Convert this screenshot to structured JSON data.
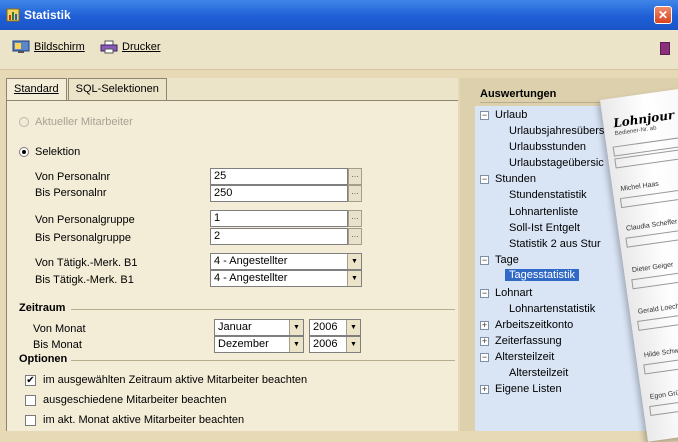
{
  "window": {
    "title": "Statistik",
    "close_glyph": "✕"
  },
  "toolbar": {
    "screen_label": "Bildschirm",
    "printer_label": "Drucker"
  },
  "tabs": [
    {
      "label": "Standard",
      "active": true
    },
    {
      "label": "SQL-Selektionen",
      "active": false
    }
  ],
  "standard": {
    "radio_current": "Aktueller Mitarbeiter",
    "radio_selection": "Selektion",
    "from_personnel_no_label": "Von Personalnr",
    "from_personnel_no": "25",
    "to_personnel_no_label": "Bis Personalnr",
    "to_personnel_no": "250",
    "from_group_label": "Von Personalgruppe",
    "from_group": "1",
    "to_group_label": "Bis Personalgruppe",
    "to_group": "2",
    "from_activity_label": "Von Tätigk.-Merk. B1",
    "from_activity": "4 - Angestellter",
    "to_activity_label": "Bis Tätigk.-Merk. B1",
    "to_activity": "4 - Angestellter",
    "period_heading": "Zeitraum",
    "from_month_label": "Von  Monat",
    "from_month": "Januar",
    "from_year": "2006",
    "to_month_label": "Bis Monat",
    "to_month": "Dezember",
    "to_year": "2006",
    "options_heading": "Optionen",
    "option_active_period": "im ausgewählten Zeitraum aktive Mitarbeiter beachten",
    "option_active_period_checked": true,
    "option_leavers": "ausgeschiedene Mitarbeiter beachten",
    "option_leavers_checked": false,
    "option_active_month": "im akt. Monat aktive Mitarbeiter beachten",
    "option_active_month_checked": false
  },
  "evaluations": {
    "heading": "Auswertungen",
    "nodes": [
      {
        "label": "Urlaub",
        "expander": "−"
      },
      {
        "label": "Urlaubsjahresübersic"
      },
      {
        "label": "Urlaubsstunden"
      },
      {
        "label": "Urlaubstageübersic"
      },
      {
        "label": "Stunden",
        "expander": "−"
      },
      {
        "label": "Stundenstatistik"
      },
      {
        "label": "Lohnartenliste"
      },
      {
        "label": "Soll-Ist Entgelt"
      },
      {
        "label": "Statistik 2 aus Stur"
      },
      {
        "label": "Tage",
        "expander": "−"
      },
      {
        "label": "Tagesstatistik",
        "selected": true
      },
      {
        "label": "Lohnart",
        "expander": "−"
      },
      {
        "label": "Lohnartenstatistik"
      },
      {
        "label": "Arbeitszeitkonto",
        "expander": "+"
      },
      {
        "label": "Zeiterfassung",
        "expander": "+"
      },
      {
        "label": "Altersteilzeit",
        "expander": "−"
      },
      {
        "label": "Altersteilzeit"
      },
      {
        "label": "Eigene Listen",
        "expander": "+"
      }
    ]
  },
  "report_preview": {
    "title": "Lohnjour",
    "subtitle": "Bediener-Nr. ab",
    "names": [
      "Michel Haas",
      "Claudia Scheffer",
      "Dieter Geiger",
      "Gerald Loeches",
      "Hilde Schwarz",
      "Egon Grüner"
    ]
  },
  "colors": {
    "titlebar": "#1f5ed6",
    "selection": "#3169c6",
    "tree_bg": "#d9e4f5",
    "panel_bg": "#f3ecd7"
  }
}
